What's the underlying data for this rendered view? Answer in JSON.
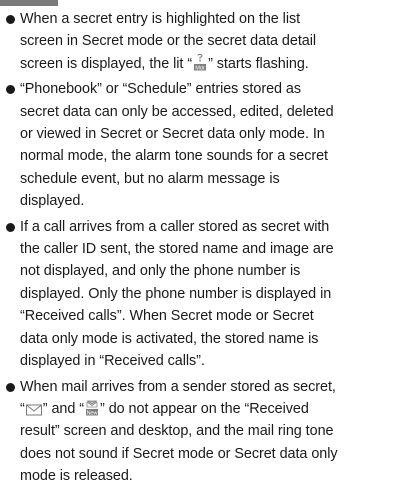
{
  "notes": [
    {
      "lines": [
        {
          "text": "When a secret entry is highlighted on the list"
        },
        {
          "text": "screen in Secret mode or the secret data detail"
        },
        {
          "pre": "screen is displayed, the lit “",
          "icon": "secret-key-icon",
          "post": "” starts flashing."
        }
      ]
    },
    {
      "lines": [
        {
          "text": "“Phonebook” or “Schedule” entries stored as"
        },
        {
          "text": "secret data can only be accessed, edited, deleted"
        },
        {
          "text": "or viewed in Secret or Secret data only mode. In"
        },
        {
          "text": "normal mode, the alarm tone sounds for a secret"
        },
        {
          "text": "schedule event, but no alarm message is"
        },
        {
          "text": "displayed."
        }
      ]
    },
    {
      "lines": [
        {
          "text": "If a call arrives from a caller stored as secret with"
        },
        {
          "text": "the caller ID sent, the stored name and image are"
        },
        {
          "text": "not displayed, and only the phone number is"
        },
        {
          "text": "displayed. Only the phone number is displayed in"
        },
        {
          "text": "“Received calls”. When Secret mode or Secret"
        },
        {
          "text": "data only mode is activated, the stored name is"
        },
        {
          "text": "displayed in “Received calls”."
        }
      ]
    },
    {
      "lines": [
        {
          "text": "When mail arrives from a sender stored as secret,"
        },
        {
          "pre": "“",
          "icon": "envelope-icon",
          "mid": "” and “",
          "icon2": "new-mail-icon",
          "post": "” do not appear on the “Received"
        },
        {
          "text": "result” screen and desktop, and the mail ring tone"
        },
        {
          "text": "does not sound if Secret mode or Secret data only"
        },
        {
          "text": "mode is released."
        }
      ]
    }
  ]
}
